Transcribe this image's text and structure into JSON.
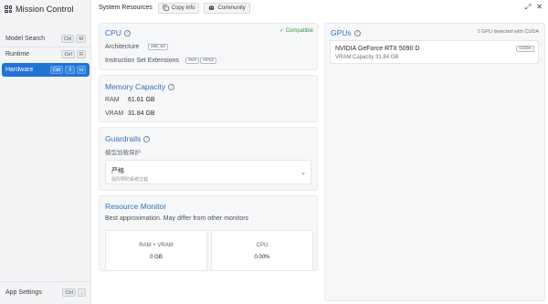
{
  "app": {
    "title": "Mission Control"
  },
  "sidebar": {
    "items": [
      {
        "label": "Model Search",
        "keys": [
          "Ctrl",
          "M"
        ]
      },
      {
        "label": "Runtime",
        "keys": [
          "Ctrl",
          "R"
        ]
      },
      {
        "label": "Hardware",
        "keys": [
          "Ctrl",
          "⇧",
          "H"
        ],
        "active": true
      }
    ],
    "footer": {
      "label": "App Settings",
      "keys": [
        "Ctrl",
        ","
      ]
    }
  },
  "topbar": {
    "title": "System Resources",
    "copy_info_label": "Copy Info",
    "community_label": "Community"
  },
  "cpu": {
    "title": "CPU",
    "status": "✓ Compatible",
    "architecture_label": "Architecture",
    "architecture_value": "x86_64",
    "isa_label": "Instruction Set Extensions",
    "isa_values": [
      "AVX",
      "AVX2"
    ]
  },
  "memory": {
    "title": "Memory Capacity",
    "ram_label": "RAM",
    "ram_value": "61.61 GB",
    "vram_label": "VRAM",
    "vram_value": "31.84 GB"
  },
  "guardrails": {
    "title": "Guardrails",
    "subtitle": "模型加载保护",
    "selected": "严格",
    "selected_desc": "强烈预防系统过载"
  },
  "monitor": {
    "title": "Resource Monitor",
    "subtitle": "Best approximation. May differ from other monitors",
    "ram_vram_label": "RAM + VRAM",
    "ram_vram_value": "0 GB",
    "cpu_label": "CPU",
    "cpu_value": "0.00%"
  },
  "gpus": {
    "title": "GPUs",
    "detected": "1 GPU detected with CUDA",
    "items": [
      {
        "name": "NVIDIA GeForce RTX 5090 D",
        "badge": "CUDA",
        "vram": "VRAM Capacity 31.84 GB"
      }
    ]
  },
  "colors": {
    "accent": "#1f74d6",
    "title_blue": "#2f6fbf",
    "compatible_green": "#2e9a4a"
  }
}
